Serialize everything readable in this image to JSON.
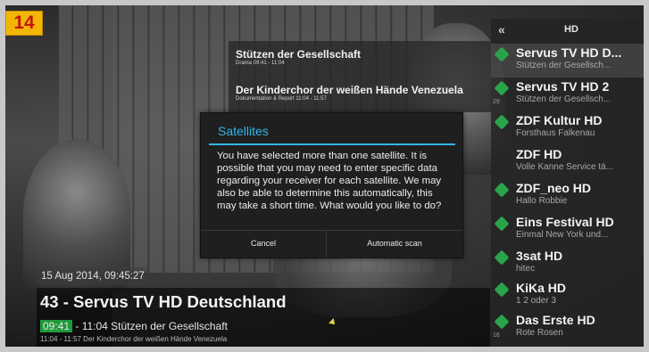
{
  "badge": {
    "number": "14"
  },
  "epg": {
    "items": [
      {
        "title": "Stützen der Gesellschaft",
        "sub": "Drama  09:41 - 11:04"
      },
      {
        "title": "Der Kinderchor der weißen Hände Venezuela",
        "sub": "Dokumentation & Report  11:04 - 11:57"
      }
    ]
  },
  "sidebar": {
    "back_glyph": "«",
    "header": "HD",
    "channels": [
      {
        "num": "",
        "name": "Servus TV HD D...",
        "prog": "Stützen der Gesellsch..."
      },
      {
        "num": "29",
        "name": "Servus TV HD 2",
        "prog": "Stützen der Gesellsch..."
      },
      {
        "num": "",
        "name": "ZDF Kultur HD",
        "prog": "Forsthaus Falkenau"
      },
      {
        "num": "",
        "name": "ZDF HD",
        "prog": "Volle Kanne Service tä..."
      },
      {
        "num": "",
        "name": "ZDF_neo HD",
        "prog": "Hallo Robbie"
      },
      {
        "num": "",
        "name": "Eins Festival HD",
        "prog": "Einmal New York und..."
      },
      {
        "num": "",
        "name": "3sat HD",
        "prog": "hitec"
      },
      {
        "num": "",
        "name": "KiKa HD",
        "prog": "1 2 oder 3"
      },
      {
        "num": "16",
        "name": "Das Erste HD",
        "prog": "Rote Rosen"
      }
    ],
    "colors": {
      "indicator": "#2aa44a"
    }
  },
  "dialog": {
    "title": "Satellites",
    "message": "You have selected more than one satellite. It is possible that you may need to enter specific data regarding your receiver for each satellite. We may also be able to determine this automatically, this may take a short time. What would you like to do?",
    "cancel_label": "Cancel",
    "scan_label": "Automatic scan",
    "accent": "#33b5e5"
  },
  "info": {
    "datetime": "15 Aug 2014, 09:45:27",
    "channel_title": "43 - Servus TV HD Deutschland",
    "now_time": "09:41",
    "now_rest": " - 11:04  Stützen der Gesellschaft",
    "next": "11:04 - 11:57  Der Kinderchor der weißen Hände Venezuela"
  }
}
